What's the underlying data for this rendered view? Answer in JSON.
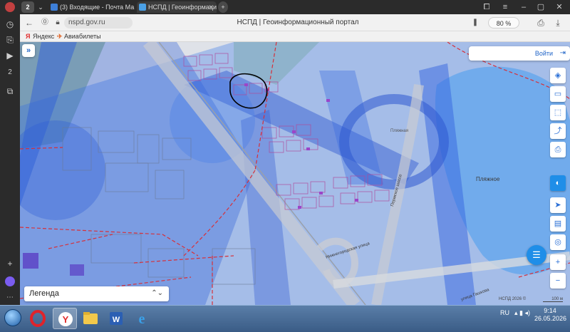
{
  "browser": {
    "tab_count": "2",
    "tabs": [
      {
        "label": "(3) Входящие - Почта Ма",
        "active": false
      },
      {
        "label": "НСПД | Геоинформаци",
        "active": true
      }
    ],
    "new_tab_label": "+",
    "url": "nspd.gov.ru",
    "page_title": "НСПД | Геоинформационный портал",
    "zoom": "80 %",
    "bookmarks": [
      "Яндекс",
      "Авиабилеты"
    ]
  },
  "map": {
    "login_label": "Войти",
    "legend_label": "Легенда",
    "labels": {
      "pond": "Пляжное",
      "street_lake": "Пляжная",
      "highway": "Пермское шоссе",
      "street_n": "Нижнегородская улица",
      "street_s": "улица Гашкова"
    },
    "attribution": "НСПД 2026 ©",
    "scale": "100 м"
  },
  "taskbar": {
    "language": "RU",
    "time": "9:14",
    "date": "26.05.2026"
  },
  "colors": {
    "browser_chrome": "#2b2b2b",
    "accent_blue": "#1e63c7",
    "overlay_blue": "#3a78e8",
    "cadastre_red": "#d6303a",
    "parcel_purple": "#9b45c9",
    "water": "#8fc7ef"
  }
}
